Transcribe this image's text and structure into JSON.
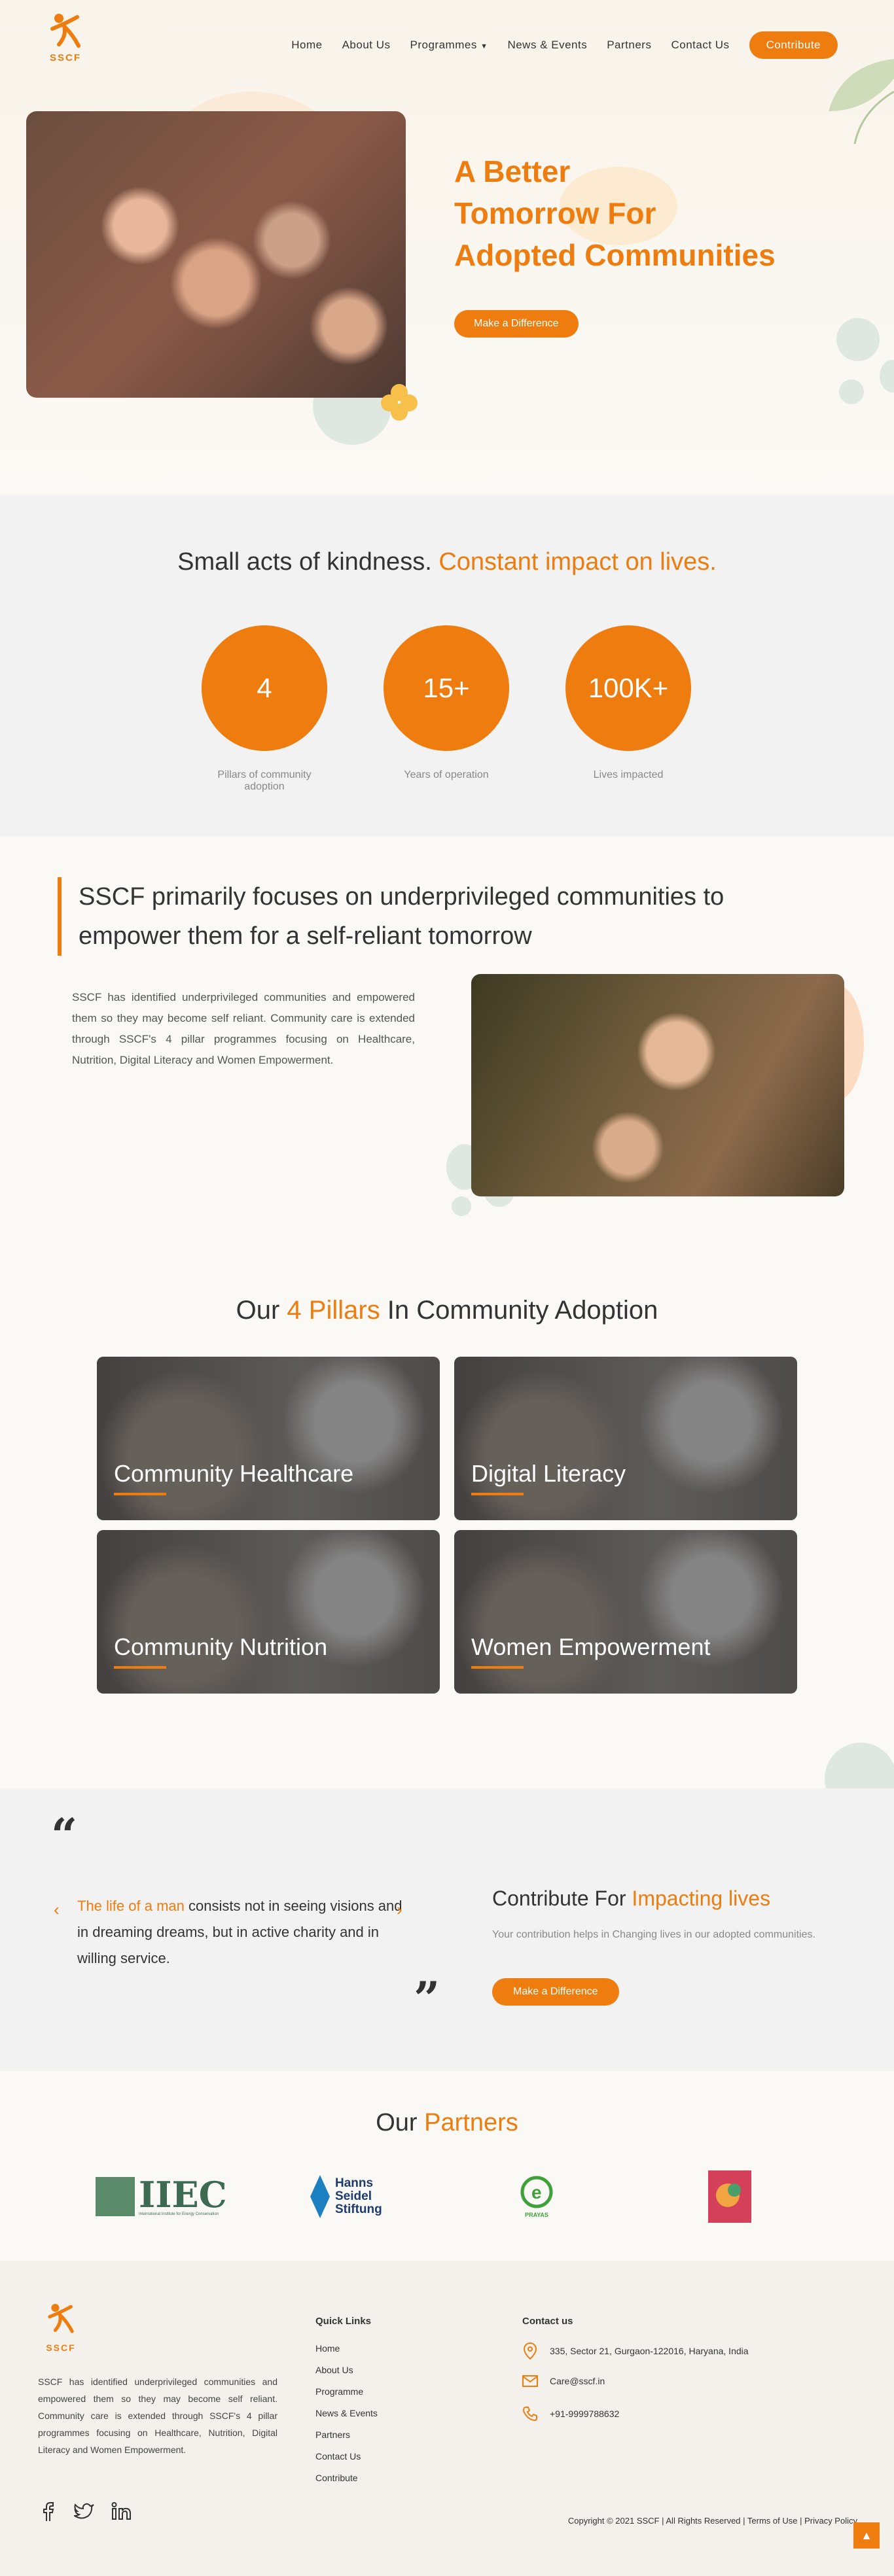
{
  "header": {
    "logo_text": "SSCF",
    "nav": [
      {
        "label": "Home"
      },
      {
        "label": "About Us"
      },
      {
        "label": "Programmes"
      },
      {
        "label": "News & Events"
      },
      {
        "label": "Partners"
      },
      {
        "label": "Contact Us"
      }
    ],
    "contribute_label": "Contribute"
  },
  "hero": {
    "title_line1": "A Better",
    "title_line2": "Tomorrow For",
    "title_line3": "Adopted Communities",
    "button": "Make a Difference"
  },
  "stats": {
    "title_plain": "Small acts of kindness. ",
    "title_accent": "Constant impact on lives.",
    "items": [
      {
        "value": "4",
        "label": "Pillars of community adoption"
      },
      {
        "value": "15+",
        "label": "Years of operation"
      },
      {
        "value": "100K+",
        "label": "Lives impacted"
      }
    ]
  },
  "focus": {
    "quote": "SSCF primarily focuses on underprivileged communities to empower them for a self-reliant tomorrow",
    "text": "SSCF has identified underprivileged communities and empowered them so they may become self reliant. Community care is extended through SSCF's 4 pillar programmes focusing on Healthcare, Nutrition, Digital Literacy and Women Empowerment."
  },
  "pillars": {
    "title_a": "Our ",
    "title_accent": "4 Pillars",
    "title_b": " In Community Adoption",
    "cards": [
      {
        "label": "Community Healthcare"
      },
      {
        "label": "Digital Literacy"
      },
      {
        "label": "Community Nutrition"
      },
      {
        "label": "Women Empowerment"
      }
    ]
  },
  "quote": {
    "accent": "The life of a man",
    "rest": " consists not in seeing visions and in dreaming dreams, but in active charity and in willing service."
  },
  "contribute": {
    "title_plain": "Contribute For ",
    "title_accent": "Impacting lives",
    "text": "Your contribution helps in Changing lives in our adopted communities.",
    "button": "Make a Difference"
  },
  "partners": {
    "title_plain": "Our ",
    "title_accent": "Partners",
    "iiec": "IIEC",
    "iiec_sub": "International Institute for Energy Conservation",
    "hss_line1": "Hanns",
    "hss_line2": "Seidel",
    "hss_line3": "Stiftung",
    "prayas": "PRAYAS"
  },
  "footer": {
    "logo_text": "SSCF",
    "description": "SSCF has identified underprivileged communities and empowered them so they may become self reliant. Community care is extended through SSCF's 4 pillar programmes focusing on Healthcare, Nutrition, Digital Literacy and Women Empowerment.",
    "quick_links_title": "Quick Links",
    "quick_links": [
      "Home",
      "About Us",
      "Programme",
      "News & Events",
      "Partners",
      "Contact Us",
      "Contribute"
    ],
    "contact_title": "Contact us",
    "address": "335, Sector 21, Gurgaon-122016, Haryana, India",
    "email": "Care@sscf.in",
    "phone": "+91-9999788632",
    "copyright": "Copyright © 2021 SSCF | All Rights Reserved | Terms of Use | Privacy Policy"
  },
  "colors": {
    "accent": "#ee7c0e"
  },
  "icons": [
    "facebook-icon",
    "twitter-icon",
    "linkedin-icon",
    "location-icon",
    "mail-icon",
    "phone-icon",
    "arrow-up-icon"
  ]
}
